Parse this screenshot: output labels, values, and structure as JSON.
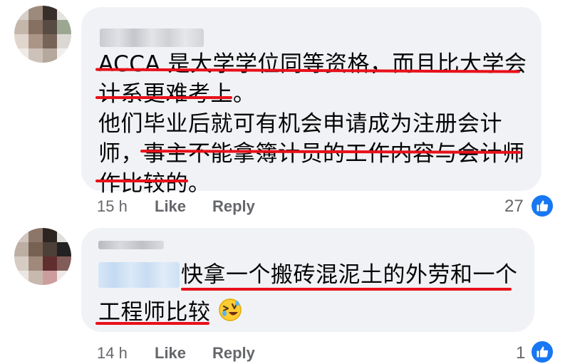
{
  "comments": [
    {
      "lines": [
        "ACCA 是大学学位同等资格，而且比大学会",
        "计系更难考上。",
        "他们毕业后就可有机会申请成为注册会计",
        "师，事主不能拿簿计员的工作内容与会计师",
        "作比较的。"
      ],
      "time": "15 h",
      "like_label": "Like",
      "reply_label": "Reply",
      "reaction_count": "27"
    },
    {
      "lines": [
        "快拿一个搬砖混泥土的外劳和一个",
        "工程师比较"
      ],
      "time": "14 h",
      "like_label": "Like",
      "reply_label": "Reply",
      "reaction_count": "1"
    }
  ],
  "colors": {
    "bubble": "#f0f2f5",
    "underline": "#e8101a",
    "meta_text": "#65676b",
    "like_blue": "#1877f2"
  },
  "icons": [
    "like-thumb-icon",
    "rolling-laughing-emoji"
  ]
}
